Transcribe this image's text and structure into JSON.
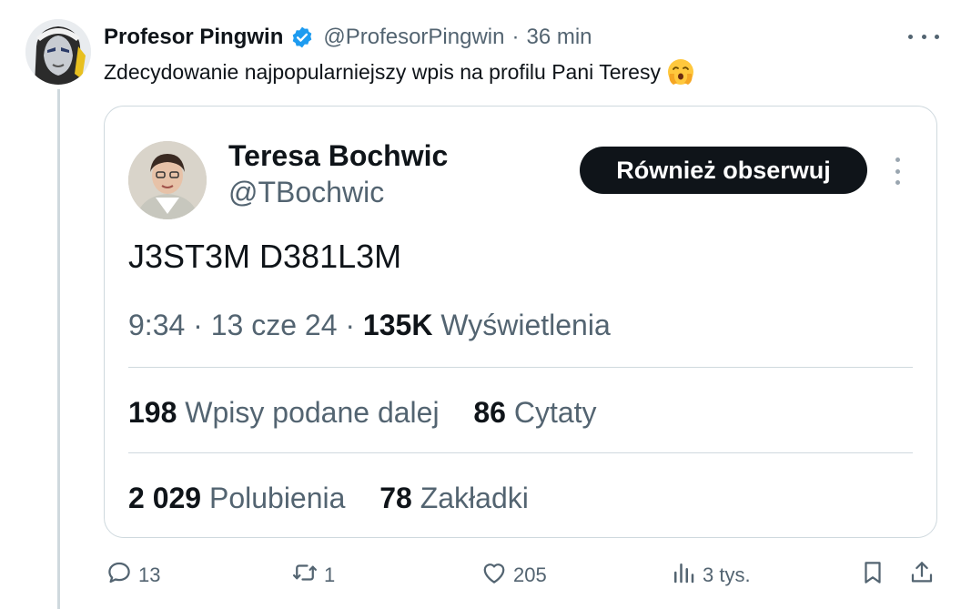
{
  "post": {
    "author_name": "Profesor Pingwin",
    "handle": "@ProfesorPingwin",
    "separator": "·",
    "time": "36 min",
    "text": "Zdecydowanie najpopularniejszy wpis na  profilu Pani Teresy"
  },
  "quote": {
    "author_name": "Teresa Bochwic",
    "handle": "@TBochwic",
    "follow_label": "Również obserwuj",
    "text": "J3ST3M D381L3M",
    "time": "9:34",
    "separator": "·",
    "date": "13 cze 24",
    "views_count": "135K",
    "views_label": "Wyświetlenia",
    "reposts_count": "198",
    "reposts_label": "Wpisy podane dalej",
    "quotes_count": "86",
    "quotes_label": "Cytaty",
    "likes_count": "2 029",
    "likes_label": "Polubienia",
    "bookmarks_count": "78",
    "bookmarks_label": "Zakładki"
  },
  "actions": {
    "reply_count": "13",
    "retweet_count": "1",
    "like_count": "205",
    "views_count": "3 tys."
  },
  "colors": {
    "text_primary": "#0f1419",
    "text_secondary": "#536471",
    "border": "#cfd9de",
    "verified_blue": "#1d9bf0",
    "button_dark": "#0f1419"
  },
  "icons": [
    "verified-icon",
    "more-icon",
    "reply-icon",
    "retweet-icon",
    "like-icon",
    "views-icon",
    "bookmark-icon",
    "share-icon",
    "emoji-icon"
  ]
}
